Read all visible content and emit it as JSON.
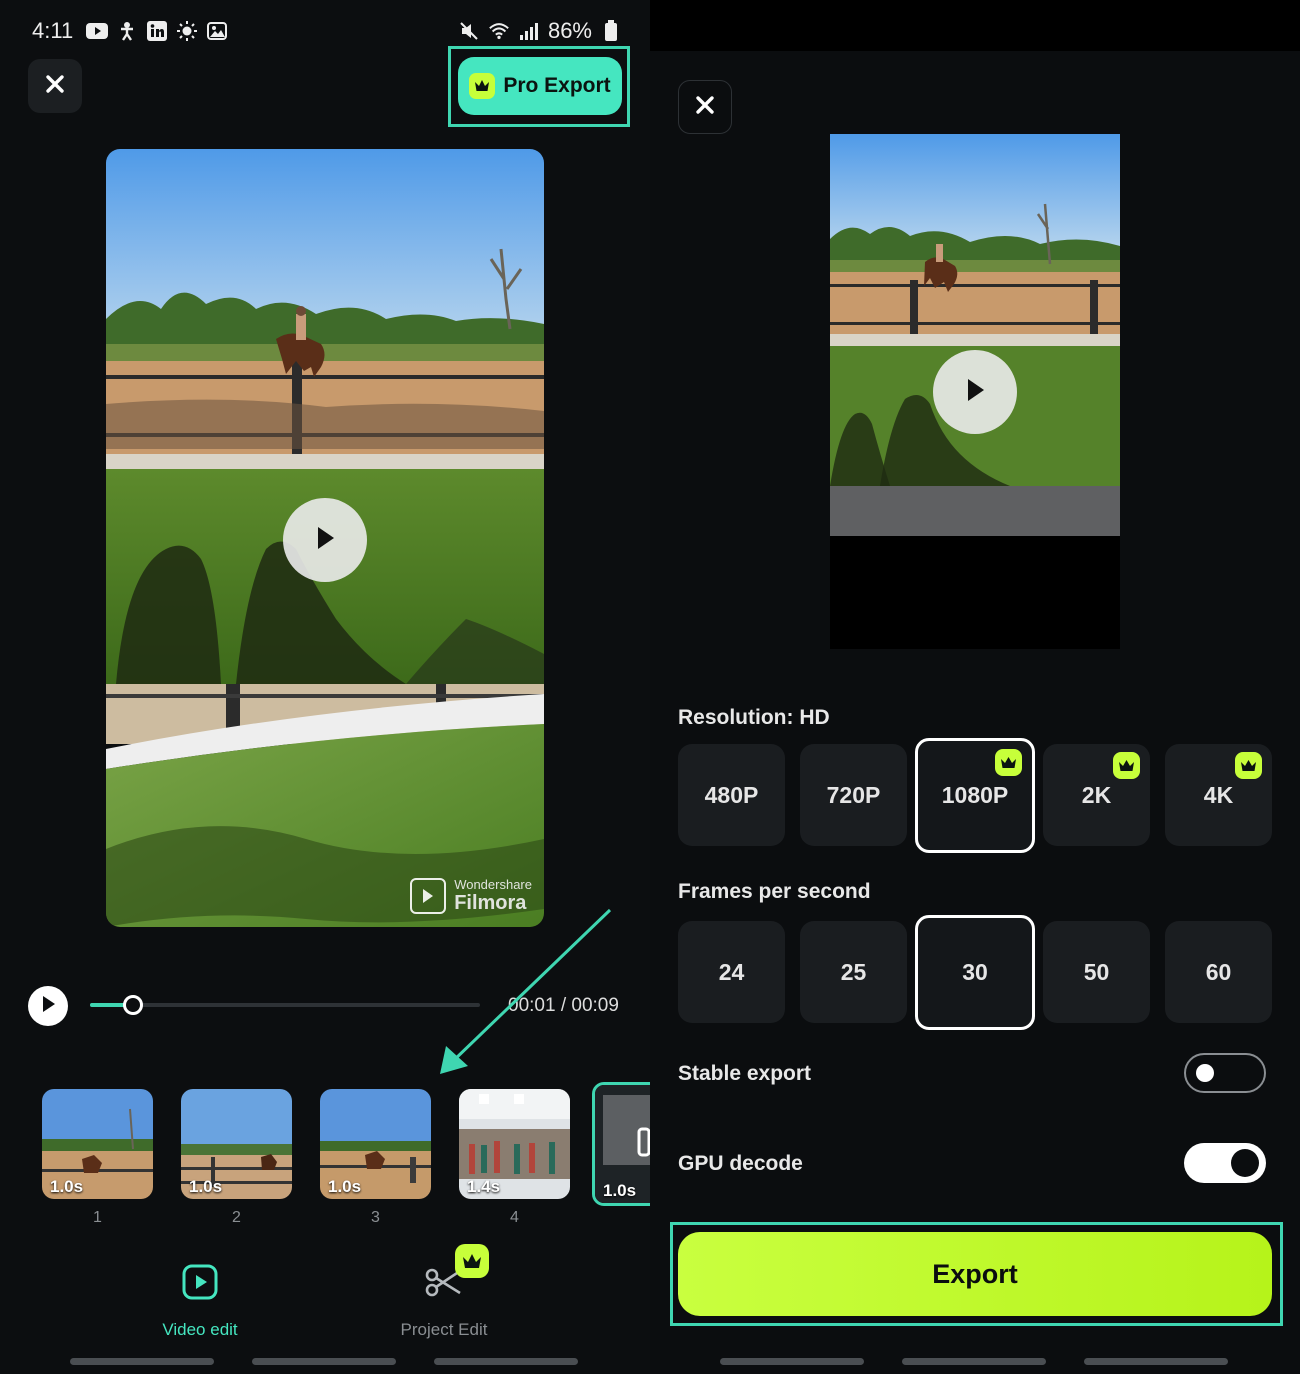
{
  "status_bar": {
    "time": "4:11",
    "battery": "86%"
  },
  "editor": {
    "pro_export_label": "Pro Export",
    "watermark": {
      "brand_small": "Wondershare",
      "brand_big": "Filmora"
    },
    "playback": {
      "current": "00:01",
      "total": "00:09",
      "separator": " / ",
      "progress": 0.11
    },
    "clips": [
      {
        "duration": "1.0s",
        "index": "1"
      },
      {
        "duration": "1.0s",
        "index": "2"
      },
      {
        "duration": "1.0s",
        "index": "3"
      },
      {
        "duration": "1.4s",
        "index": "4"
      },
      {
        "duration": "1.0s",
        "index": ""
      }
    ],
    "tabs": {
      "video_edit": "Video edit",
      "project_edit": "Project Edit"
    }
  },
  "export": {
    "resolution_label": "Resolution: HD",
    "resolutions": [
      {
        "label": "480P",
        "premium": false,
        "selected": false
      },
      {
        "label": "720P",
        "premium": false,
        "selected": false
      },
      {
        "label": "1080P",
        "premium": true,
        "selected": true
      },
      {
        "label": "2K",
        "premium": true,
        "selected": false
      },
      {
        "label": "4K",
        "premium": true,
        "selected": false
      }
    ],
    "fps_label": "Frames per second",
    "fps_options": [
      {
        "label": "24",
        "selected": false
      },
      {
        "label": "25",
        "selected": false
      },
      {
        "label": "30",
        "selected": true
      },
      {
        "label": "50",
        "selected": false
      },
      {
        "label": "60",
        "selected": false
      }
    ],
    "stable_export": {
      "label": "Stable export",
      "on": false
    },
    "gpu_decode": {
      "label": "GPU decode",
      "on": true
    },
    "export_button": "Export"
  },
  "colors": {
    "accent_teal": "#45e6c0",
    "accent_lime": "#c7ff3a",
    "background": "#0b0d0f"
  }
}
